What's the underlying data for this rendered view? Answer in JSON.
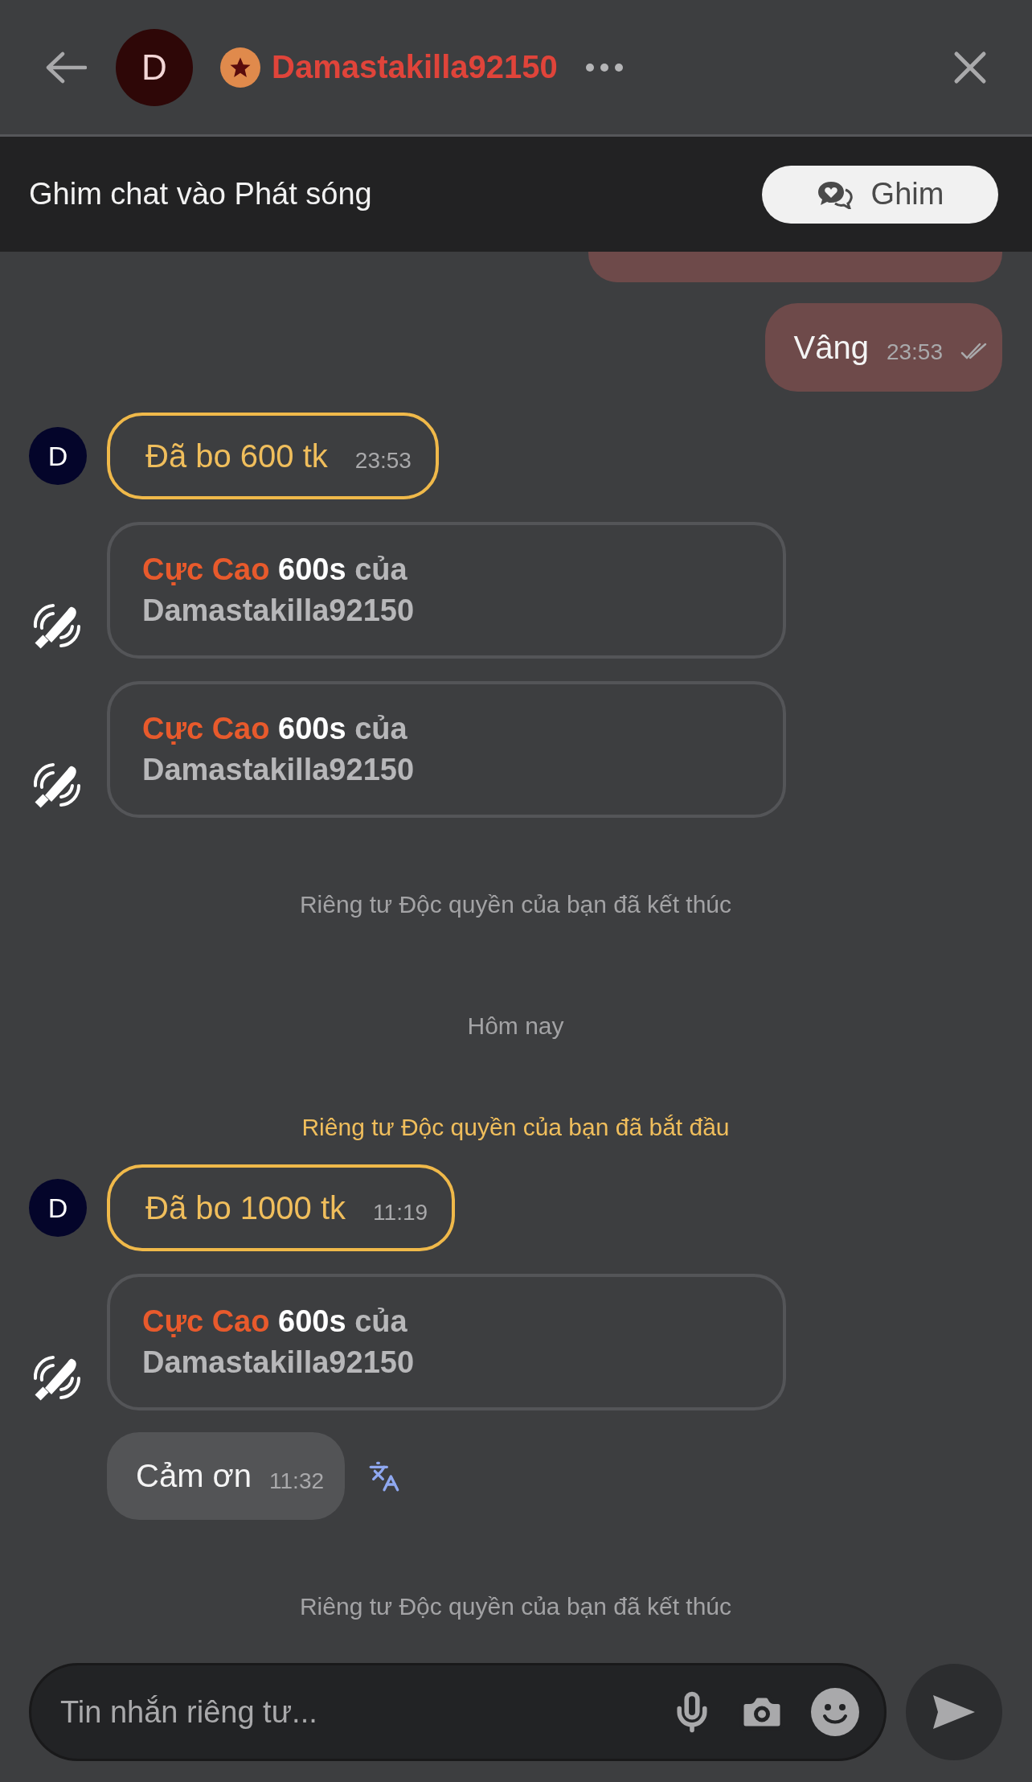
{
  "header": {
    "avatar_letter": "D",
    "username": "Damastakilla92150"
  },
  "pin_banner": {
    "text": "Ghim chat vào Phát sóng",
    "button": "Ghim"
  },
  "messages": [
    {
      "kind": "partial"
    },
    {
      "kind": "outgoing",
      "text": "Vâng",
      "time": "23:53",
      "read": true
    },
    {
      "kind": "tip",
      "avatar_letter": "D",
      "text": "Đã bo 600 tk",
      "time": "23:53"
    },
    {
      "kind": "gift",
      "tier": "Cực Cao",
      "duration": "600s",
      "connector": "của",
      "sender": "Damastakilla92150"
    },
    {
      "kind": "gift",
      "tier": "Cực Cao",
      "duration": "600s",
      "connector": "của",
      "sender": "Damastakilla92150"
    },
    {
      "kind": "system",
      "text": "Riêng tư Độc quyền của bạn đã kết thúc",
      "highlight": false
    },
    {
      "kind": "date",
      "text": "Hôm nay"
    },
    {
      "kind": "system",
      "text": "Riêng tư Độc quyền của bạn đã bắt đầu",
      "highlight": true
    },
    {
      "kind": "tip",
      "avatar_letter": "D",
      "text": "Đã bo 1000 tk",
      "time": "11:19"
    },
    {
      "kind": "gift",
      "tier": "Cực Cao",
      "duration": "600s",
      "connector": "của",
      "sender": "Damastakilla92150"
    },
    {
      "kind": "incoming",
      "text": "Cảm ơn",
      "time": "11:32"
    },
    {
      "kind": "system",
      "text": "Riêng tư Độc quyền của bạn đã kết thúc",
      "highlight": false
    }
  ],
  "composer": {
    "placeholder": "Tin nhắn riêng tư..."
  }
}
